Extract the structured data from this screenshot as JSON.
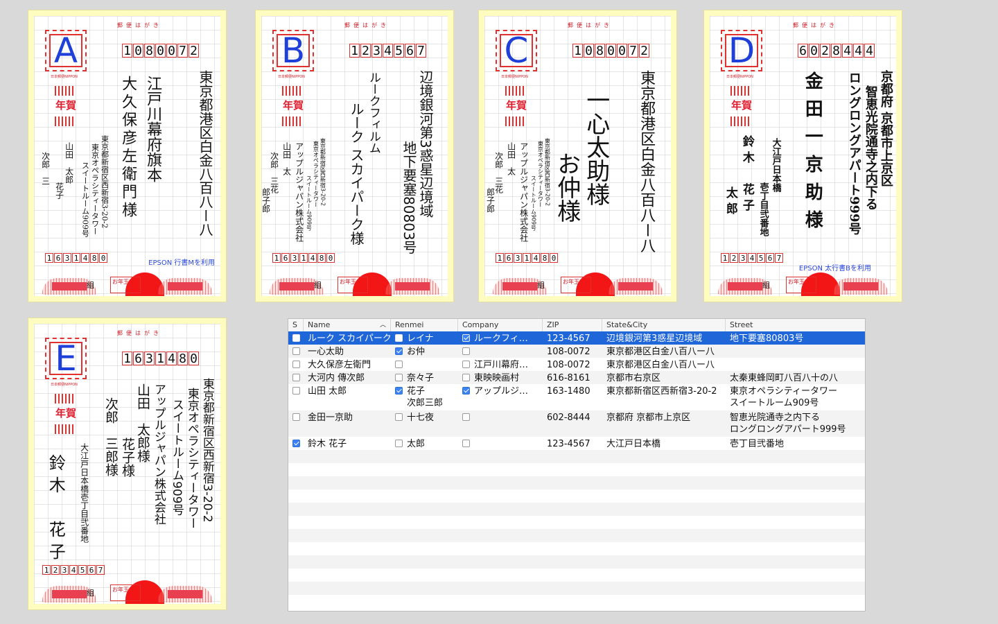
{
  "cards": [
    {
      "id": "A",
      "letter": "A",
      "postcard_header": "郵便はがき",
      "stamp_brand": "日本郵便NIPPON",
      "nenga_label": "年賀",
      "to_zip": [
        "1",
        "0",
        "8",
        "0",
        "0",
        "7",
        "2"
      ],
      "from_zip": [
        "1",
        "6",
        "3",
        "1",
        "4",
        "8",
        "0"
      ],
      "to_address": "東京都港区白金八百八ー八",
      "to_company": "江戸川幕府旗本",
      "to_name": "大久保彦左衛門様",
      "from_address": "東京都新宿区西新宿3-20-2",
      "from_address2": "東京オペラシティータワー",
      "from_address3": "スイートルーム909号",
      "from_name": "山田　太郎",
      "from_name2": "花子",
      "from_name3": "次郎　三",
      "font_note": "EPSON 行書Mを利用",
      "lottery_kumi": "組",
      "lottery_otoshi": "お年玉"
    },
    {
      "id": "B",
      "letter": "B",
      "postcard_header": "郵便はがき",
      "stamp_brand": "日本郵便NIPPON",
      "nenga_label": "年賀",
      "to_zip": [
        "1",
        "2",
        "3",
        "4",
        "5",
        "6",
        "7"
      ],
      "from_zip": [
        "1",
        "6",
        "3",
        "1",
        "4",
        "8",
        "0"
      ],
      "to_address": "辺境銀河第3惑星辺境域",
      "to_address2": "地下要塞80803号",
      "to_company": "ルークフィルム",
      "to_name": "ルーク スカイパーク様",
      "from_address": "東京都新宿区西新宿3-20-2",
      "from_address2": "東京オペラシティータワー",
      "from_address3": "スイートルーム909号",
      "from_company": "アップルジャパン株式会社",
      "from_name": "山田　太",
      "from_name2": "次郎　三花",
      "from_name3": "郎子郎",
      "font_note": "",
      "lottery_kumi": "組",
      "lottery_otoshi": "お年玉"
    },
    {
      "id": "C",
      "letter": "C",
      "postcard_header": "郵便はがき",
      "stamp_brand": "日本郵便NIPPON",
      "nenga_label": "年賀",
      "to_zip": [
        "1",
        "0",
        "8",
        "0",
        "0",
        "7",
        "2"
      ],
      "from_zip": [
        "1",
        "6",
        "3",
        "1",
        "4",
        "8",
        "0"
      ],
      "to_address": "東京都港区白金八百八ー八",
      "to_name": "一心太助様",
      "to_name2": "お仲様",
      "from_address": "東京都新宿区西新宿3-20-2",
      "from_address2": "東京オペラシティータワー",
      "from_address3": "スイートルーム909号",
      "from_company": "アップルジャパン株式会社",
      "from_name": "山田　太",
      "from_name2": "次郎　三花",
      "from_name3": "郎子郎",
      "font_note": "",
      "lottery_kumi": "組",
      "lottery_otoshi": "お年玉"
    },
    {
      "id": "D",
      "letter": "D",
      "postcard_header": "郵便はがき",
      "stamp_brand": "日本郵便NIPPON",
      "nenga_label": "年賀",
      "to_zip": [
        "6",
        "0",
        "2",
        "8",
        "4",
        "4",
        "4"
      ],
      "from_zip": [
        "1",
        "2",
        "3",
        "4",
        "5",
        "6",
        "7"
      ],
      "to_address": "京都府 京都市上京区",
      "to_address2": "智恵光院通寺之内下る",
      "to_address3": "ロングロングアパート999号",
      "to_name": "金田一京助様",
      "from_address": "大江戸日本橋",
      "from_address2": "壱丁目弐番地",
      "from_name": "鈴木　花子",
      "from_name2": "太郎",
      "font_note": "EPSON 太行書Bを利用",
      "lottery_kumi": "組",
      "lottery_otoshi": "お年玉"
    },
    {
      "id": "E",
      "letter": "E",
      "postcard_header": "郵便はがき",
      "stamp_brand": "日本郵便NIPPON",
      "nenga_label": "年賀",
      "to_zip": [
        "1",
        "6",
        "3",
        "1",
        "4",
        "8",
        "0"
      ],
      "from_zip": [
        "1",
        "2",
        "3",
        "4",
        "5",
        "6",
        "7"
      ],
      "to_address": "東京都新宿区西新宿3-20-2",
      "to_address2": "東京オペラシティータワー",
      "to_address3": "スイートルーム909号",
      "to_company": "アップルジャパン株式会社",
      "to_name": "山田　太郎様",
      "to_name2": "花子様",
      "to_name3": "次郎　三郎様",
      "from_address": "大江戸日本橋壱丁目弐番地",
      "from_name": "鈴木　花子",
      "font_note": "",
      "lottery_kumi": "組",
      "lottery_otoshi": "お年玉"
    }
  ],
  "table": {
    "columns": [
      {
        "key": "s",
        "label": "S"
      },
      {
        "key": "name",
        "label": "Name",
        "sort_indicator": "^"
      },
      {
        "key": "renmei",
        "label": "Renmei"
      },
      {
        "key": "company",
        "label": "Company"
      },
      {
        "key": "zip",
        "label": "ZIP"
      },
      {
        "key": "statecity",
        "label": "State&City"
      },
      {
        "key": "street",
        "label": "Street"
      }
    ],
    "rows": [
      {
        "s": false,
        "name": "ルーク スカイパーク",
        "renmei_cb": false,
        "renmei": "レイナ",
        "company_cb": true,
        "company": "ルークフィ…",
        "zip": "123-4567",
        "statecity": "辺境銀河第3惑星辺境域",
        "street": "地下要塞80803号",
        "street2": "",
        "renmei2": "",
        "selected": true
      },
      {
        "s": false,
        "name": "一心太助",
        "renmei_cb": true,
        "renmei": "お仲",
        "company_cb": false,
        "company": "",
        "zip": "108-0072",
        "statecity": "東京都港区白金八百八ー八",
        "street": "",
        "street2": "",
        "renmei2": "",
        "selected": false
      },
      {
        "s": false,
        "name": "大久保彦左衛門",
        "renmei_cb": false,
        "renmei": "",
        "company_cb": false,
        "company": "江戸川幕府…",
        "zip": "108-0072",
        "statecity": "東京都港区白金八百八ー八",
        "street": "",
        "street2": "",
        "renmei2": "",
        "selected": false
      },
      {
        "s": false,
        "name": "大河内 傳次郎",
        "renmei_cb": false,
        "renmei": "奈々子",
        "company_cb": false,
        "company": "東映映画村",
        "zip": "616-8161",
        "statecity": "京都市右京区",
        "street": "太秦東蜂岡町八百八十の八",
        "street2": "",
        "renmei2": "",
        "selected": false
      },
      {
        "s": false,
        "name": "山田 太郎",
        "renmei_cb": true,
        "renmei": "花子",
        "company_cb": true,
        "company": "アップルジ…",
        "zip": "163-1480",
        "statecity": "東京都新宿区西新宿3-20-2",
        "street": "東京オペラシティータワー",
        "street2": "スイートルーム909号",
        "renmei2": "次郎三郎",
        "selected": false
      },
      {
        "s": false,
        "name": "金田一京助",
        "renmei_cb": false,
        "renmei": "十七夜",
        "company_cb": false,
        "company": "",
        "zip": "602-8444",
        "statecity": "京都府 京都市上京区",
        "street": "智恵光院通寺之内下る",
        "street2": "ロングロングアパート999号",
        "renmei2": "",
        "selected": false
      },
      {
        "s": true,
        "name": "鈴木 花子",
        "renmei_cb": false,
        "renmei": "太郎",
        "company_cb": false,
        "company": "",
        "zip": "123-4567",
        "statecity": "大江戸日本橋",
        "street": "壱丁目弐番地",
        "street2": "",
        "renmei2": "",
        "selected": false
      }
    ]
  }
}
